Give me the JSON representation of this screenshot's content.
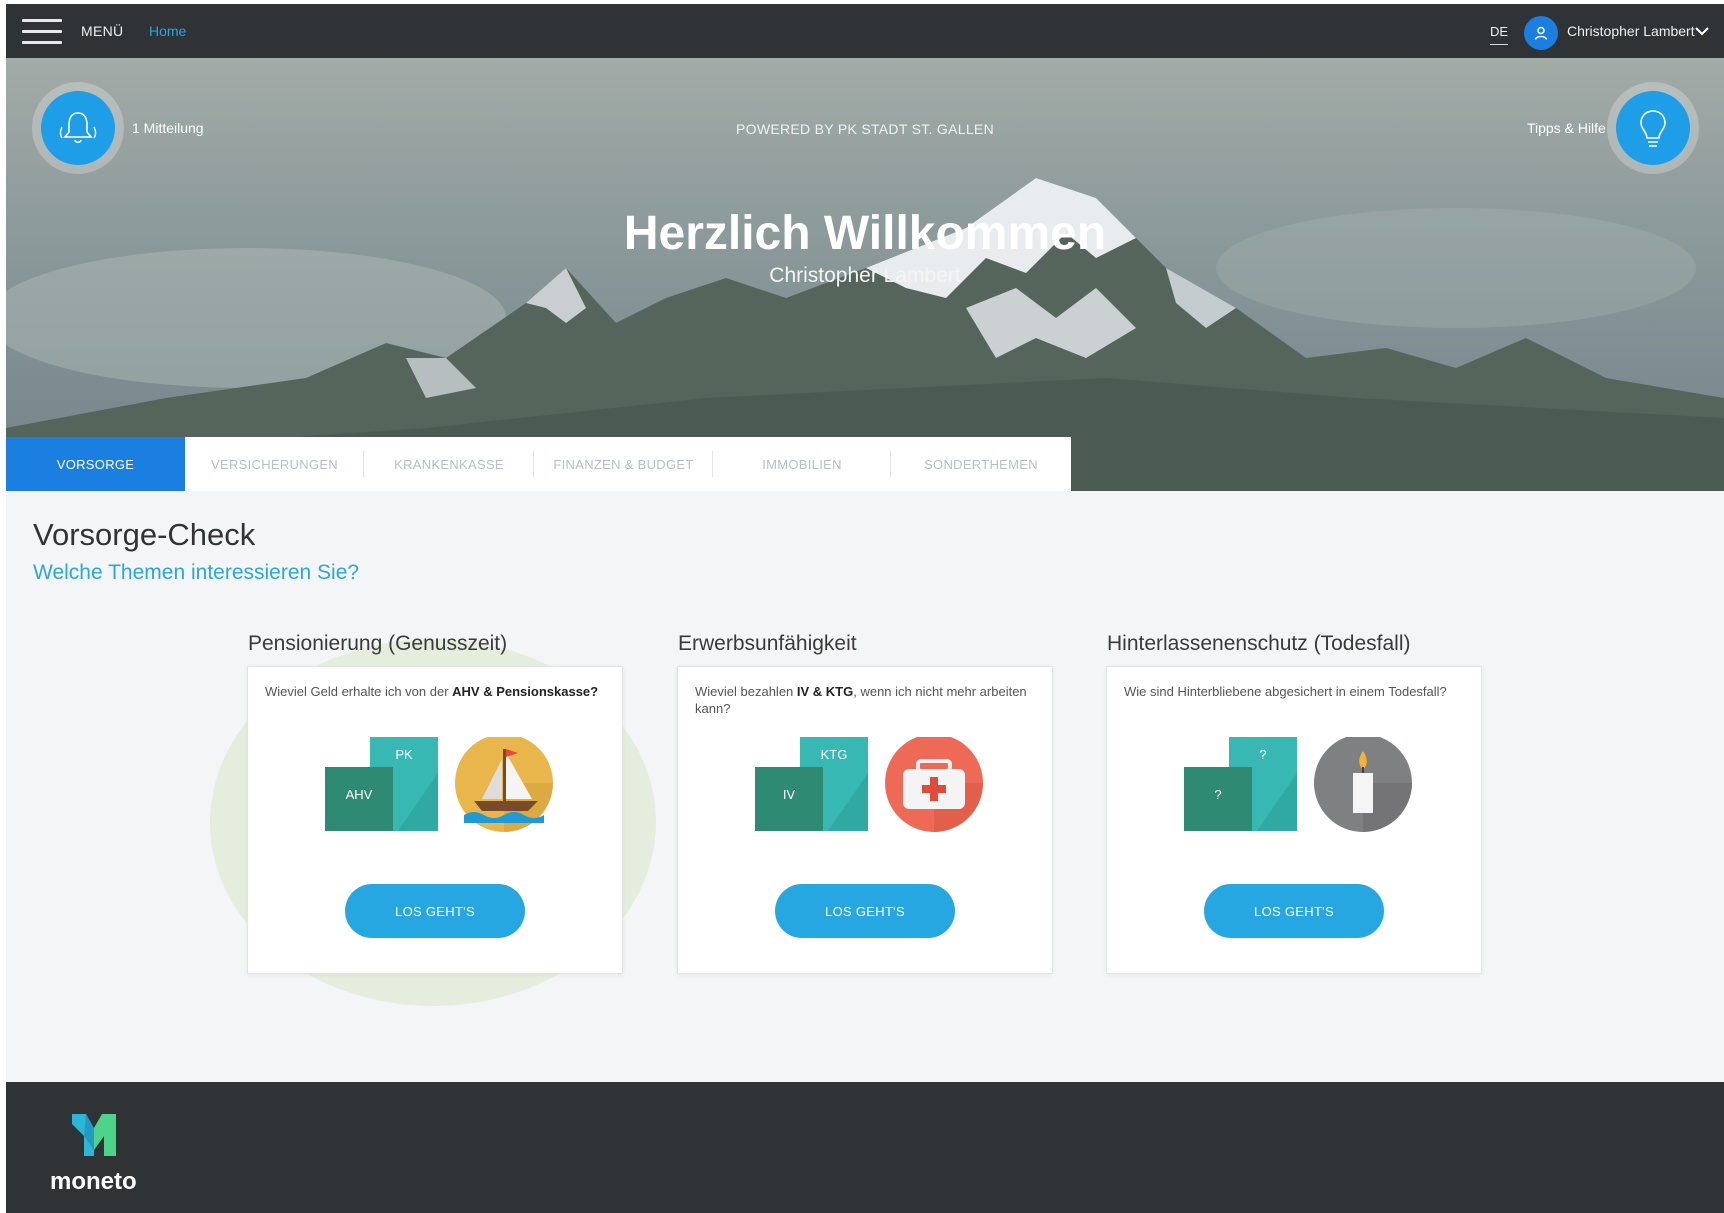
{
  "topbar": {
    "menu_label": "MENÜ",
    "home_link": "Home",
    "language": "DE",
    "user_name": "Christopher Lambert"
  },
  "hero": {
    "notification_label": "1 Mitteilung",
    "powered_by": "POWERED BY PK STADT ST. GALLEN",
    "title": "Herzlich Willkommen",
    "subtitle": "Christopher Lambert",
    "tips_label": "Tipps & Hilfe"
  },
  "tabs": [
    {
      "label": "VORSORGE"
    },
    {
      "label": "VERSICHERUNGEN"
    },
    {
      "label": "KRANKENKASSE"
    },
    {
      "label": "FINANZEN & BUDGET"
    },
    {
      "label": "IMMOBILIEN"
    },
    {
      "label": "SONDERTHEMEN"
    }
  ],
  "main": {
    "title": "Vorsorge-Check",
    "subtitle": "Welche Themen interessieren Sie?"
  },
  "cards": [
    {
      "title": "Pensionierung (Genusszeit)",
      "question_pre": "Wieviel Geld erhalte ich von der ",
      "question_bold": "AHV & Pensionskasse?",
      "question_mid": "",
      "question_bold2": "",
      "question_post": "",
      "doc_back": "PK",
      "doc_front": "AHV",
      "icon": "sailboat-icon",
      "icon_color": "#e8b64a",
      "button": "LOS GEHT'S"
    },
    {
      "title": "Erwerbsunfähigkeit",
      "question_pre": "Wieviel bezahlen ",
      "question_bold": "IV & KTG",
      "question_mid": ", wenn ich nicht mehr arbeiten kann?",
      "question_bold2": "",
      "question_post": "",
      "doc_back": "KTG",
      "doc_front": "IV",
      "icon": "first-aid-kit-icon",
      "icon_color": "#ee6a57",
      "button": "LOS GEHT'S"
    },
    {
      "title": "Hinterlassenenschutz (Todesfall)",
      "question_pre": "Wie sind Hinterbliebene abgesichert in einem Todesfall?",
      "question_bold": "",
      "question_mid": "",
      "question_bold2": "",
      "question_post": "",
      "doc_back": "?",
      "doc_front": "?",
      "icon": "candle-icon",
      "icon_color": "#7f8082",
      "button": "LOS GEHT'S"
    }
  ],
  "footer": {
    "brand": "moneto"
  },
  "colors": {
    "accent": "#1a7fe0",
    "button": "#27a7e2",
    "dark": "#2f3336",
    "doc_dark": "#2f8a74",
    "doc_light": "#38b8b2"
  }
}
